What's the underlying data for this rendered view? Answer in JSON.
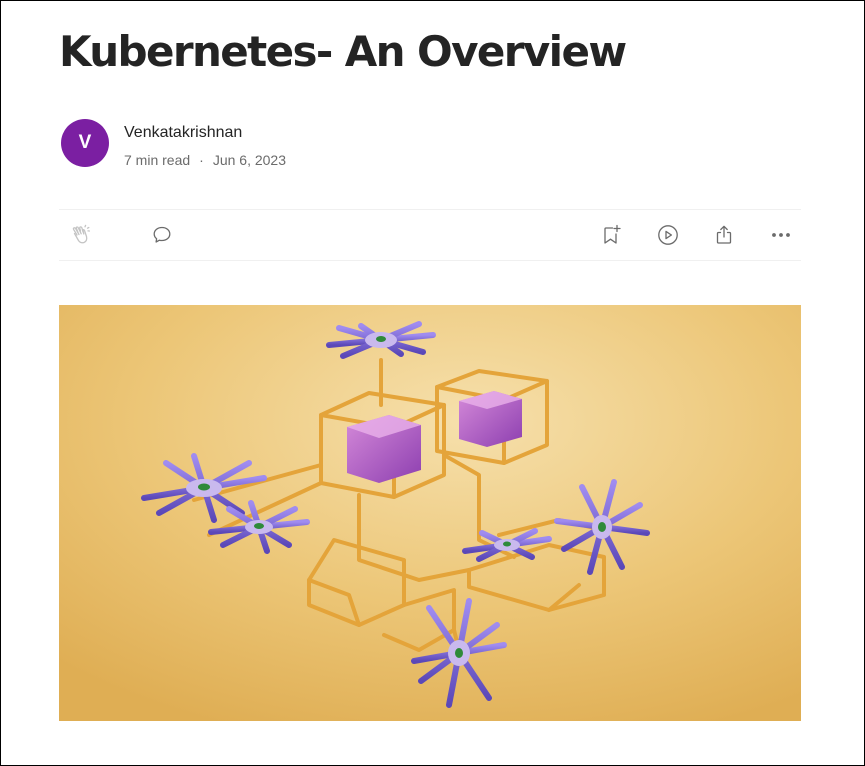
{
  "article": {
    "title": "Kubernetes- An Overview"
  },
  "author": {
    "initial": "V",
    "name": "Venkatakrishnan",
    "avatar_color": "#7b1fa2"
  },
  "meta": {
    "read_time": "7 min read",
    "separator": "·",
    "date": "Jun 6, 2023"
  },
  "actions": {
    "left": [
      {
        "name": "clap",
        "icon": "clap-icon"
      },
      {
        "name": "response",
        "icon": "speech-bubble-icon"
      }
    ],
    "right": [
      {
        "name": "save",
        "icon": "bookmark-add-icon"
      },
      {
        "name": "listen",
        "icon": "play-circle-icon"
      },
      {
        "name": "share",
        "icon": "share-icon"
      },
      {
        "name": "more",
        "icon": "more-dots-icon"
      }
    ]
  },
  "hero": {
    "background_color": "#e9c06d",
    "accent_colors": [
      "#e8a63a",
      "#b15bc0",
      "#7a6ad0"
    ]
  }
}
